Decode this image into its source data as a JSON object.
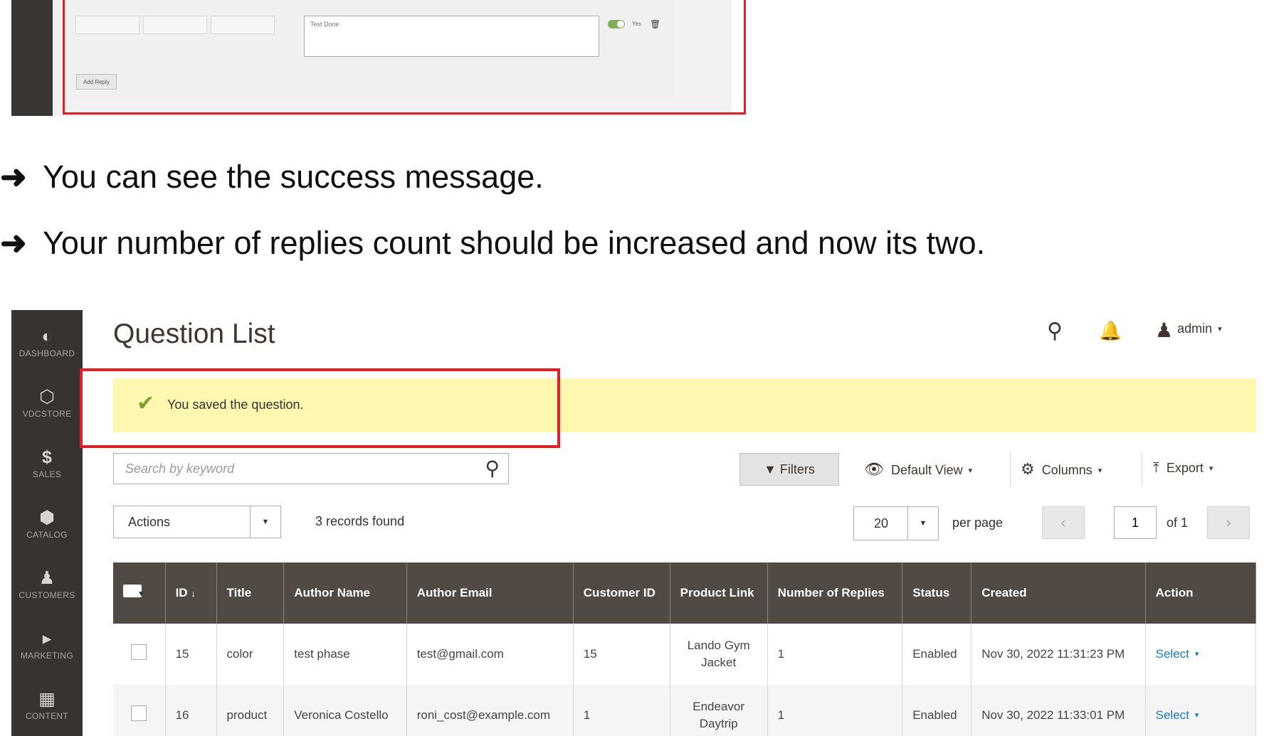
{
  "top_shot": {
    "reply_placeholder": "Test Done",
    "toggle_label": "Yes",
    "add_reply_label": "Add Reply"
  },
  "bullets": [
    "You can see the success message.",
    "Your number of replies count should be increased and now its two."
  ],
  "sidebar": {
    "items": [
      {
        "label": "DASHBOARD",
        "icon": "dashboard-icon"
      },
      {
        "label": "VDCSTORE",
        "icon": "hexagon-icon"
      },
      {
        "label": "SALES",
        "icon": "dollar-icon"
      },
      {
        "label": "CATALOG",
        "icon": "box-icon"
      },
      {
        "label": "CUSTOMERS",
        "icon": "person-icon"
      },
      {
        "label": "MARKETING",
        "icon": "megaphone-icon"
      },
      {
        "label": "CONTENT",
        "icon": "layout-icon"
      }
    ]
  },
  "header": {
    "title": "Question List",
    "user": "admin"
  },
  "message": {
    "text": "You saved the question.",
    "color": "#fdf7b0"
  },
  "toolbar": {
    "search_placeholder": "Search by keyword",
    "filters": "Filters",
    "default_view": "Default View",
    "columns": "Columns",
    "export": "Export",
    "actions": "Actions",
    "records_found": "3 records found",
    "per_page_value": "20",
    "per_page_label": "per page",
    "page": "1",
    "of_pages": "of 1"
  },
  "grid": {
    "columns": [
      "ID",
      "Title",
      "Author Name",
      "Author Email",
      "Customer ID",
      "Product Link",
      "Number of Replies",
      "Status",
      "Created",
      "Action"
    ],
    "rows": [
      {
        "id": "15",
        "title": "color",
        "author_name": "test phase",
        "author_email": "test@gmail.com",
        "customer_id": "15",
        "product_link": "Lando Gym Jacket",
        "replies": "1",
        "status": "Enabled",
        "created": "Nov 30, 2022 11:31:23 PM",
        "action": "Select"
      },
      {
        "id": "16",
        "title": "product",
        "author_name": "Veronica Costello",
        "author_email": "roni_cost@example.com",
        "customer_id": "1",
        "product_link": "Endeavor Daytrip",
        "replies": "1",
        "status": "Enabled",
        "created": "Nov 30, 2022 11:33:01 PM",
        "action": "Select"
      }
    ]
  },
  "colors": {
    "accent_red": "#e21f26",
    "sidebar": "#373330",
    "grid_header": "#514943",
    "link": "#1979c3",
    "check": "#79a22e"
  }
}
